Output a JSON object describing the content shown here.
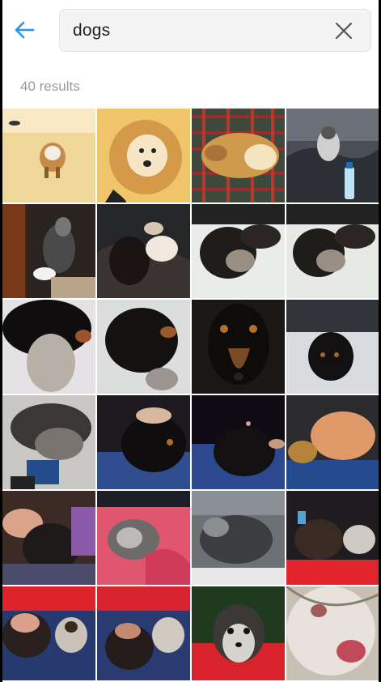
{
  "search": {
    "query": "dogs",
    "back_icon": "back-arrow-icon",
    "clear_icon": "close-icon"
  },
  "results_label": "40 results",
  "colors": {
    "accent": "#2196f3",
    "background": "#ffffff",
    "search_field": "#f4f4f4",
    "muted_text": "#9a9a9a"
  },
  "photos": [
    "photo-1",
    "photo-2",
    "photo-3",
    "photo-4",
    "photo-5",
    "photo-6",
    "photo-7",
    "photo-8",
    "photo-9",
    "photo-10",
    "photo-11",
    "photo-12",
    "photo-13",
    "photo-14",
    "photo-15",
    "photo-16",
    "photo-17",
    "photo-18",
    "photo-19",
    "photo-20",
    "photo-21",
    "photo-22",
    "photo-23",
    "photo-24"
  ]
}
